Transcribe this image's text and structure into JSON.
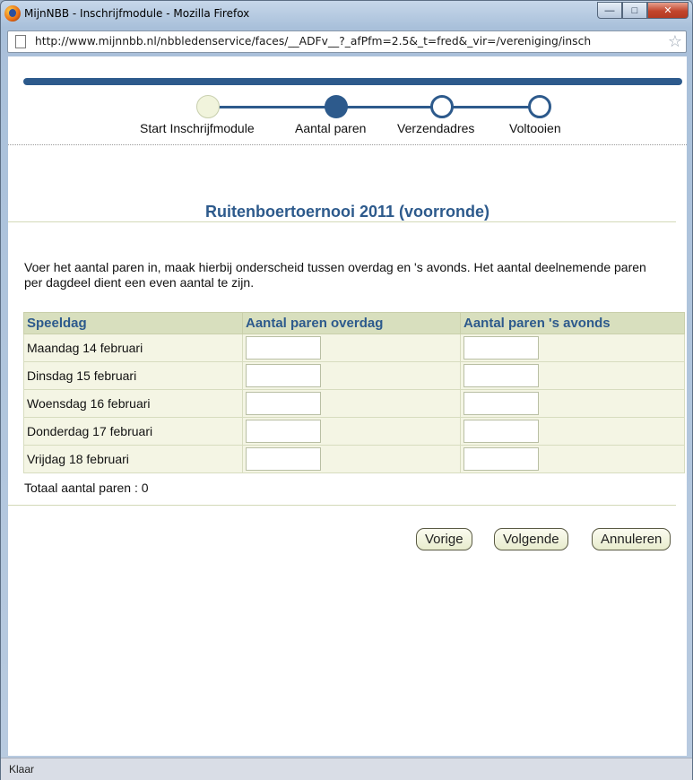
{
  "window": {
    "title": "MijnNBB - Inschrijfmodule - Mozilla Firefox",
    "url": "http://www.mijnnbb.nl/nbbledenservice/faces/__ADFv__?_afPfm=2.5&_t=fred&_vir=/vereniging/insch",
    "status": "Klaar"
  },
  "train": {
    "steps": [
      {
        "label": "Start Inschrijfmodule",
        "state": "visited"
      },
      {
        "label": "Aantal paren",
        "state": "current"
      },
      {
        "label": "Verzendadres",
        "state": "future"
      },
      {
        "label": "Voltooien",
        "state": "future"
      }
    ]
  },
  "page": {
    "heading": "Ruitenboertoernooi 2011 (voorronde)",
    "instructions": "Voer het aantal paren in, maak hierbij onderscheid tussen overdag en 's avonds. Het aantal deelnemende paren per dagdeel dient een even aantal te zijn.",
    "total": "Totaal aantal paren : 0"
  },
  "table": {
    "headers": [
      "Speeldag",
      "Aantal paren overdag",
      "Aantal paren 's avonds"
    ],
    "rows": [
      {
        "day": "Maandag 14 februari",
        "overdag": "",
        "avonds": ""
      },
      {
        "day": "Dinsdag 15 februari",
        "overdag": "",
        "avonds": ""
      },
      {
        "day": "Woensdag 16 februari",
        "overdag": "",
        "avonds": ""
      },
      {
        "day": "Donderdag 17 februari",
        "overdag": "",
        "avonds": ""
      },
      {
        "day": "Vrijdag 18 februari",
        "overdag": "",
        "avonds": ""
      }
    ]
  },
  "buttons": {
    "previous": "Vorige",
    "next": "Volgende",
    "cancel": "Annuleren"
  },
  "colors": {
    "accent": "#2d5a8c",
    "table_header_bg": "#d8dfbe",
    "table_bg": "#f4f5e4"
  }
}
